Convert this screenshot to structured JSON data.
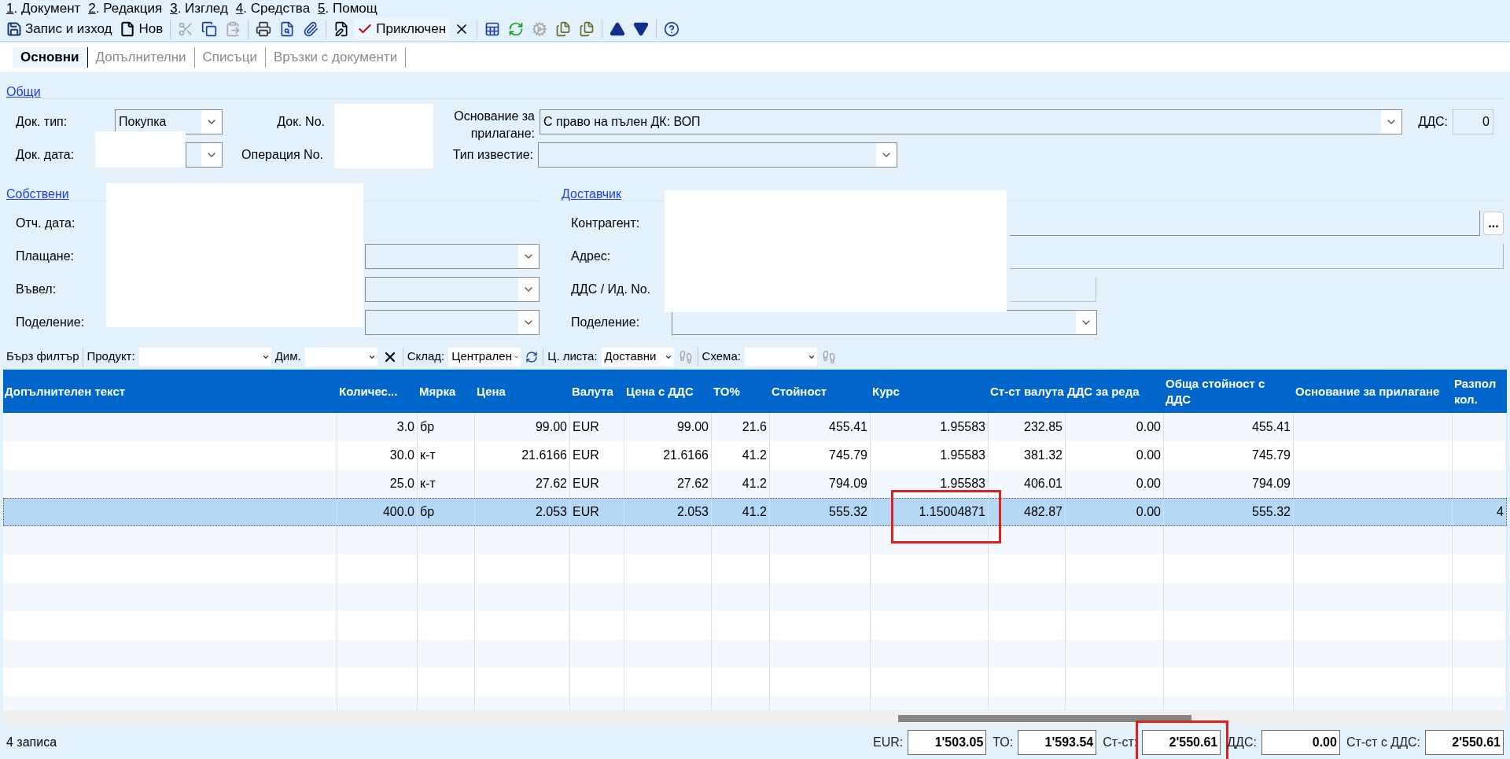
{
  "menu": [
    {
      "mnemonic": "1",
      "label": ". Документ"
    },
    {
      "mnemonic": "2",
      "label": ". Редакция"
    },
    {
      "mnemonic": "3",
      "label": ". Изглед"
    },
    {
      "mnemonic": "4",
      "label": ". Средства"
    },
    {
      "mnemonic": "5",
      "label": ". Помощ"
    }
  ],
  "toolbar": [
    {
      "kind": "button",
      "label": "Запис и изход",
      "disabled": false
    },
    {
      "kind": "button",
      "label": "Нов",
      "disabled": false
    },
    {
      "kind": "separator"
    },
    {
      "kind": "icon",
      "disabled": true
    },
    {
      "kind": "icon",
      "disabled": false
    },
    {
      "kind": "icon",
      "disabled": true
    },
    {
      "kind": "separator"
    },
    {
      "kind": "icon",
      "disabled": false
    },
    {
      "kind": "icon",
      "disabled": false
    },
    {
      "kind": "icon",
      "disabled": false
    },
    {
      "kind": "separator"
    },
    {
      "kind": "icon",
      "disabled": false
    },
    {
      "kind": "button",
      "label": "Приключен",
      "disabled": false
    },
    {
      "kind": "icon",
      "disabled": false
    },
    {
      "kind": "separator"
    },
    {
      "kind": "icon",
      "disabled": false
    },
    {
      "kind": "icon",
      "disabled": false
    },
    {
      "kind": "icon",
      "disabled": true
    },
    {
      "kind": "icon",
      "disabled": false
    },
    {
      "kind": "icon",
      "disabled": false
    },
    {
      "kind": "separator"
    },
    {
      "kind": "icon",
      "disabled": false
    },
    {
      "kind": "icon",
      "disabled": false
    },
    {
      "kind": "separator"
    },
    {
      "kind": "icon",
      "disabled": false
    }
  ],
  "tabs": [
    {
      "label": "Основни",
      "selected": true
    },
    {
      "label": "Допълнителни",
      "selected": false
    },
    {
      "label": "Списъци",
      "selected": false
    },
    {
      "label": "Връзки с документи",
      "selected": false
    }
  ],
  "general": {
    "title": "Общи",
    "doc_type": {
      "label": "Док. тип:",
      "value": "Покупка"
    },
    "doc_no": {
      "label": "Док. No."
    },
    "basis": {
      "label": "Основание за прилагане:",
      "value": "С право на пълен ДК: ВОП"
    },
    "vat": {
      "label": "ДДС:",
      "value": "0"
    },
    "doc_date": {
      "label": "Док. дата:"
    },
    "operation_no": {
      "label": "Операция No."
    },
    "notice_type": {
      "label": "Тип известие:"
    }
  },
  "own": {
    "title": "Собствени",
    "fields": [
      {
        "label": "Отч. дата:",
        "kind": "hidden"
      },
      {
        "label": "Плащане:",
        "kind": "dropdown"
      },
      {
        "label": "Въвел:",
        "kind": "dropdown"
      },
      {
        "label": "Поделение:",
        "kind": "dropdown"
      }
    ]
  },
  "supplier": {
    "title": "Доставчик",
    "fields": [
      {
        "label": "Контрагент:",
        "kind": "lookup",
        "button": "..."
      },
      {
        "label": "Адрес:",
        "kind": "text"
      },
      {
        "label": "ДДС / Ид. No.",
        "kind": "short"
      },
      {
        "label": "Поделение:",
        "kind": "dropdown"
      }
    ]
  },
  "filter": {
    "button": "Бърз филтър",
    "product": {
      "label": "Продукт:"
    },
    "dimension": {
      "label": "Дим."
    },
    "warehouse": {
      "label": "Склад:",
      "value": "Централен"
    },
    "price_list": {
      "label": "Ц. листа:",
      "value": "Доставни"
    },
    "scheme": {
      "label": "Схема:"
    }
  },
  "table": {
    "columns": [
      "Допълнителен текст",
      "Количес...",
      "Мярка",
      "Цена",
      "Валута",
      "Цена с ДДС",
      "ТО%",
      "Стойност",
      "Курс",
      "Ст-ст валута",
      "ДДС за реда",
      "Обща стойност с ДДС",
      "Основание за прилагане",
      "Разпол кол."
    ],
    "rows": [
      {
        "selected": false,
        "rate_outlined": false,
        "cells": [
          "",
          "3.0",
          "бр",
          "99.00",
          "EUR",
          "99.00",
          "21.6",
          "455.41",
          "1.95583",
          "232.85",
          "0.00",
          "455.41"
        ]
      },
      {
        "selected": false,
        "rate_outlined": false,
        "cells": [
          "",
          "30.0",
          "к-т",
          "21.6166",
          "EUR",
          "21.6166",
          "41.2",
          "745.79",
          "1.95583",
          "381.32",
          "0.00",
          "745.79"
        ]
      },
      {
        "selected": false,
        "rate_outlined": false,
        "cells": [
          "",
          "25.0",
          "к-т",
          "27.62",
          "EUR",
          "27.62",
          "41.2",
          "794.09",
          "1.95583",
          "406.01",
          "0.00",
          "794.09"
        ]
      },
      {
        "selected": true,
        "rate_outlined": true,
        "cells": [
          "",
          "400.0",
          "бр",
          "2.053",
          "EUR",
          "2.053",
          "41.2",
          "555.32",
          "1.15004871",
          "482.87",
          "0.00",
          "555.32",
          "",
          "4"
        ]
      }
    ]
  },
  "status": {
    "records": "4 записа",
    "totals": [
      {
        "label": "EUR:",
        "value": "1'503.05"
      },
      {
        "label": "ТО:",
        "value": "1'593.54"
      },
      {
        "label": "Ст-ст:",
        "value": "2'550.61",
        "outlined": true
      },
      {
        "label": "ДДС:",
        "value": "0.00"
      },
      {
        "label": "Ст-ст с ДДС:",
        "value": "2'550.61"
      }
    ]
  }
}
